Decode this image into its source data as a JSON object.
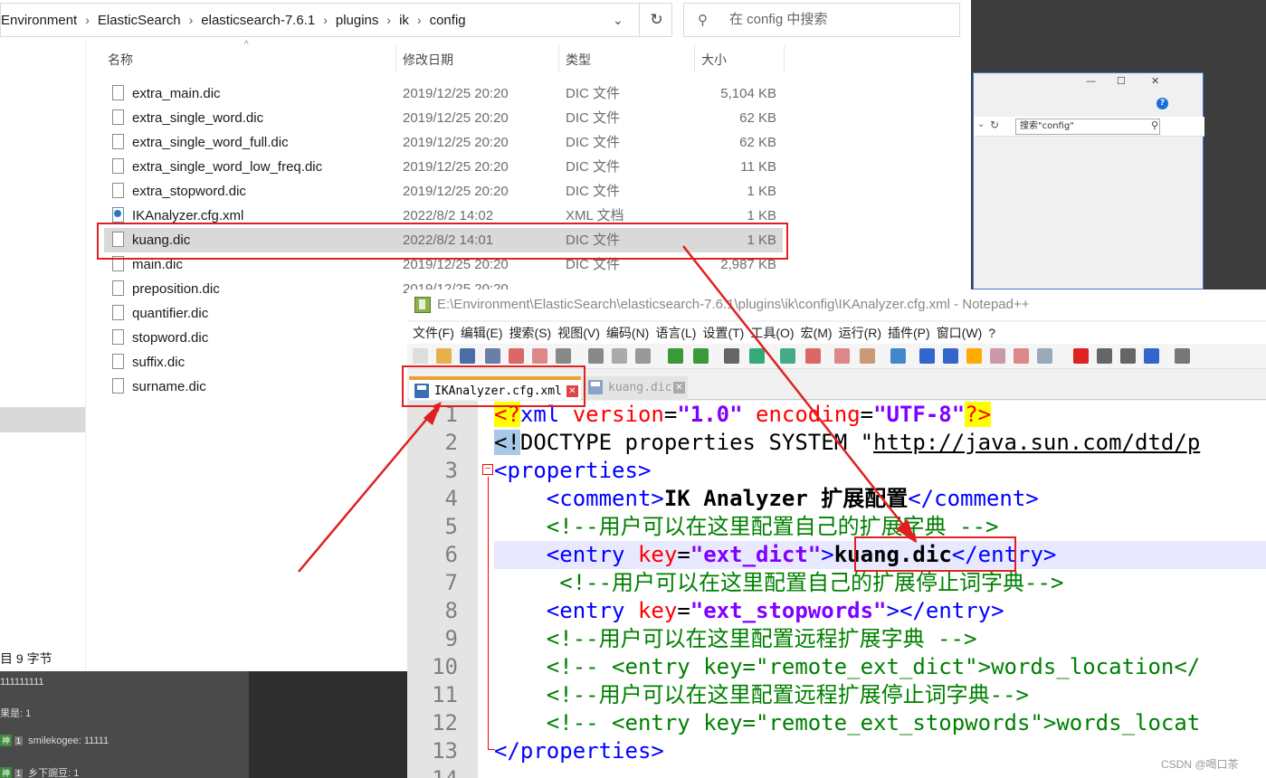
{
  "explorer": {
    "breadcrumb": [
      "Environment",
      "ElasticSearch",
      "elasticsearch-7.6.1",
      "plugins",
      "ik",
      "config"
    ],
    "search_placeholder": "在 config 中搜索",
    "columns": {
      "name": "名称",
      "date": "修改日期",
      "type": "类型",
      "size": "大小"
    },
    "files": [
      {
        "name": "extra_main.dic",
        "date": "2019/12/25 20:20",
        "type": "DIC 文件",
        "size": "5,104 KB",
        "icon": "file-icon"
      },
      {
        "name": "extra_single_word.dic",
        "date": "2019/12/25 20:20",
        "type": "DIC 文件",
        "size": "62 KB",
        "icon": "file-icon"
      },
      {
        "name": "extra_single_word_full.dic",
        "date": "2019/12/25 20:20",
        "type": "DIC 文件",
        "size": "62 KB",
        "icon": "file-icon"
      },
      {
        "name": "extra_single_word_low_freq.dic",
        "date": "2019/12/25 20:20",
        "type": "DIC 文件",
        "size": "11 KB",
        "icon": "file-icon"
      },
      {
        "name": "extra_stopword.dic",
        "date": "2019/12/25 20:20",
        "type": "DIC 文件",
        "size": "1 KB",
        "icon": "file-icon"
      },
      {
        "name": "IKAnalyzer.cfg.xml",
        "date": "2022/8/2 14:02",
        "type": "XML 文档",
        "size": "1 KB",
        "icon": "xml-file-icon"
      },
      {
        "name": "kuang.dic",
        "date": "2022/8/2 14:01",
        "type": "DIC 文件",
        "size": "1 KB",
        "icon": "file-icon",
        "selected": true
      },
      {
        "name": "main.dic",
        "date": "2019/12/25 20:20",
        "type": "DIC 文件",
        "size": "2,987 KB",
        "icon": "file-icon"
      },
      {
        "name": "preposition.dic",
        "date": "2019/12/25 20:20",
        "type": "",
        "size": "",
        "icon": "file-icon"
      },
      {
        "name": "quantifier.dic",
        "date": "",
        "type": "",
        "size": "",
        "icon": "file-icon"
      },
      {
        "name": "stopword.dic",
        "date": "",
        "type": "",
        "size": "",
        "icon": "file-icon"
      },
      {
        "name": "suffix.dic",
        "date": "",
        "type": "",
        "size": "",
        "icon": "file-icon"
      },
      {
        "name": "surname.dic",
        "date": "",
        "type": "",
        "size": "",
        "icon": "file-icon"
      }
    ],
    "status": "目  9 字节"
  },
  "bg_window": {
    "search_placeholder": "搜索\"config\"",
    "help": "?"
  },
  "chat": [
    {
      "text": "111111111",
      "level": ""
    },
    {
      "text": "果是: 1",
      "level": ""
    },
    {
      "text": "smilekogee: 11111",
      "level": "1"
    },
    {
      "text": "乡下豌豆: 1",
      "level": "1"
    }
  ],
  "notepad": {
    "title": "E:\\Environment\\ElasticSearch\\elasticsearch-7.6.1\\plugins\\ik\\config\\IKAnalyzer.cfg.xml - Notepad++",
    "menu": [
      "文件(F)",
      "编辑(E)",
      "搜索(S)",
      "视图(V)",
      "编码(N)",
      "语言(L)",
      "设置(T)",
      "工具(O)",
      "宏(M)",
      "运行(R)",
      "插件(P)",
      "窗口(W)",
      "?"
    ],
    "tabs": [
      {
        "label": "IKAnalyzer.cfg.xml",
        "active": true
      },
      {
        "label": "kuang.dic",
        "active": false
      }
    ],
    "line_numbers": [
      "1",
      "2",
      "3",
      "4",
      "5",
      "6",
      "7",
      "8",
      "9",
      "10",
      "11",
      "12",
      "13",
      "14"
    ],
    "lines": {
      "l1": {
        "a": "<?",
        "b": "xml",
        "c": " version",
        "d": "=",
        "e": "\"1.0\"",
        "f": " encoding",
        "g": "=",
        "h": "\"UTF-8\"",
        "i": "?>"
      },
      "l2": {
        "a": "<!",
        "b": "DOCTYPE properties SYSTEM \"",
        "c": "http://java.sun.com/dtd/p"
      },
      "l3": {
        "a": "<properties>"
      },
      "l4": {
        "a": "    <comment>",
        "b": "IK Analyzer 扩展配置",
        "c": "</comment>"
      },
      "l5": {
        "a": "    <!--用户可以在这里配置自己的扩展字典 -->"
      },
      "l6": {
        "a": "    <entry ",
        "b": "key",
        "c": "=",
        "d": "\"ext_dict\"",
        "e": ">",
        "f": "kuang.dic",
        "g": "</entry>"
      },
      "l7": {
        "a": "     <!--用户可以在这里配置自己的扩展停止词字典-->"
      },
      "l8": {
        "a": "    <entry ",
        "b": "key",
        "c": "=",
        "d": "\"ext_stopwords\"",
        "e": "></entry>"
      },
      "l9": {
        "a": "    <!--用户可以在这里配置远程扩展字典 -->"
      },
      "l10": {
        "a": "    <!-- <entry key=\"remote_ext_dict\">words_location</"
      },
      "l11": {
        "a": "    <!--用户可以在这里配置远程扩展停止词字典-->"
      },
      "l12": {
        "a": "    <!-- <entry key=\"remote_ext_stopwords\">words_locat"
      },
      "l13": {
        "a": "</properties>"
      }
    },
    "fold_marker": "−"
  },
  "watermark": "CSDN @喝口茶"
}
